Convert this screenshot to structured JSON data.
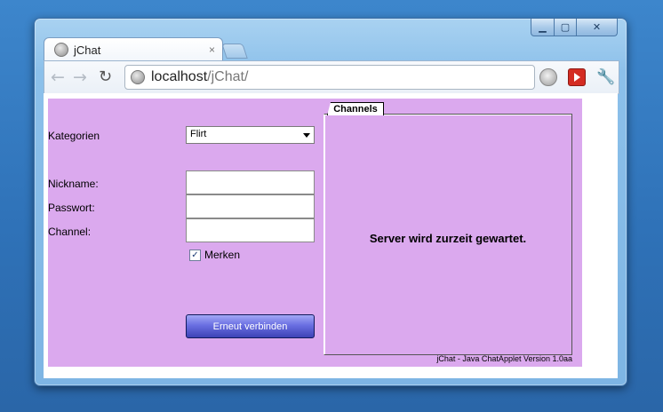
{
  "browser": {
    "tab_title": "jChat",
    "tab_close": "×",
    "url_host": "localhost",
    "url_path": "/jChat/",
    "window_controls": {
      "minimize": "▁",
      "maximize": "▢",
      "close": "✕"
    },
    "icons": [
      "back-icon",
      "forward-icon",
      "reload-icon",
      "page-icon",
      "download-icon",
      "youtube-icon",
      "wrench-icon"
    ]
  },
  "applet": {
    "background_color": "#dba9ee",
    "kategorien_label": "Kategorien",
    "kategorie_selected": "Flirt",
    "nickname_label": "Nickname:",
    "passwort_label": "Passwort:",
    "channel_label": "Channel:",
    "nickname_value": "",
    "passwort_value": "",
    "channel_value": "",
    "merken_checked": true,
    "merken_label": "Merken",
    "reconnect_button": "Erneut verbinden",
    "channels_tab": "Channels",
    "server_message": "Server wird zurzeit gewartet.",
    "version": "jChat - Java ChatApplet Version 1.0aa"
  }
}
